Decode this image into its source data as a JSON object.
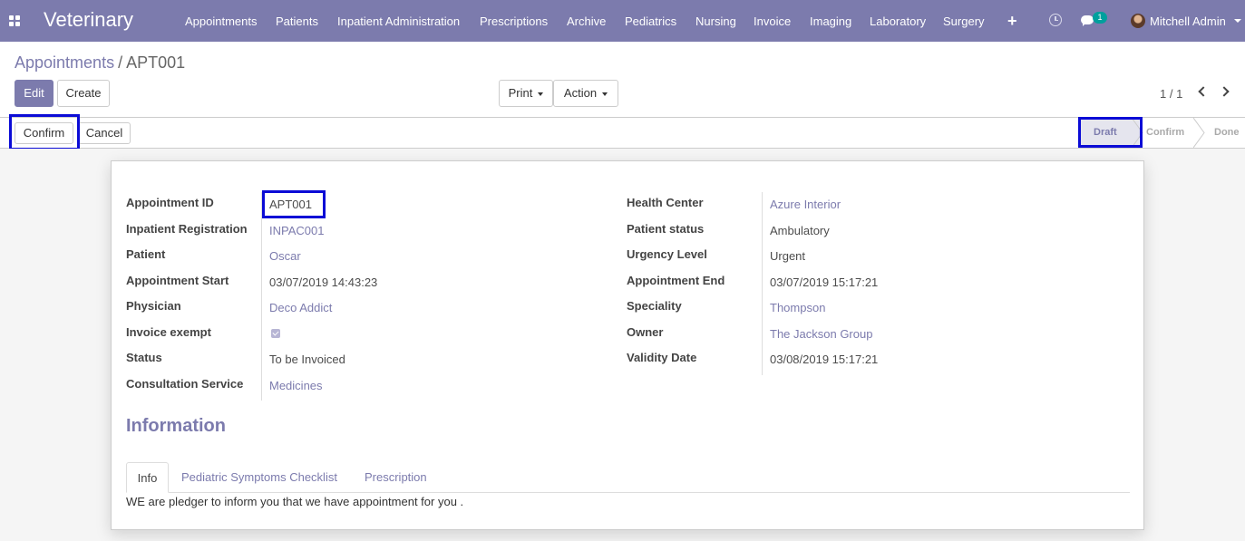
{
  "navbar": {
    "brand": "Veterinary",
    "menu": [
      "Appointments",
      "Patients",
      "Inpatient Administration",
      "Prescriptions",
      "Archive",
      "Pediatrics",
      "Nursing",
      "Invoice",
      "Imaging",
      "Laboratory",
      "Surgery"
    ],
    "chat_count": "1",
    "user": "Mitchell Admin"
  },
  "breadcrumb": {
    "parent": "Appointments",
    "separator": "/",
    "current": "APT001"
  },
  "buttons": {
    "edit": "Edit",
    "create": "Create",
    "print": "Print",
    "action": "Action"
  },
  "pager": {
    "value": "1 / 1"
  },
  "statusbar": {
    "confirm": "Confirm",
    "cancel": "Cancel",
    "steps": [
      "Draft",
      "Confirm",
      "Done"
    ],
    "active_step": "Draft"
  },
  "form": {
    "left": [
      {
        "label": "Appointment ID",
        "value": "APT001",
        "type": "text"
      },
      {
        "label": "Inpatient Registration",
        "value": "INPAC001",
        "type": "link"
      },
      {
        "label": "Patient",
        "value": "Oscar",
        "type": "link"
      },
      {
        "label": "Appointment Start",
        "value": "03/07/2019 14:43:23",
        "type": "text"
      },
      {
        "label": "Physician",
        "value": "Deco Addict",
        "type": "link"
      },
      {
        "label": "Invoice exempt",
        "value": true,
        "type": "checkbox"
      },
      {
        "label": "Status",
        "value": "To be Invoiced",
        "type": "text"
      },
      {
        "label": "Consultation Service",
        "value": "Medicines",
        "type": "link"
      }
    ],
    "right": [
      {
        "label": "Health Center",
        "value": "Azure Interior",
        "type": "link"
      },
      {
        "label": "Patient status",
        "value": "Ambulatory",
        "type": "text"
      },
      {
        "label": "Urgency Level",
        "value": "Urgent",
        "type": "text"
      },
      {
        "label": "Appointment End",
        "value": "03/07/2019 15:17:21",
        "type": "text"
      },
      {
        "label": "Speciality",
        "value": "Thompson",
        "type": "link"
      },
      {
        "label": "Owner",
        "value": "The Jackson Group",
        "type": "link"
      },
      {
        "label": "Validity Date",
        "value": "03/08/2019 15:17:21",
        "type": "text"
      }
    ],
    "section_title": "Information",
    "tabs": [
      "Info",
      "Pediatric Symptoms Checklist",
      "Prescription"
    ],
    "info_text": "WE are pledger to inform you that we have appointment for you ."
  },
  "colors": {
    "brand": "#7c7bad",
    "highlight": "#0b0bd6"
  }
}
